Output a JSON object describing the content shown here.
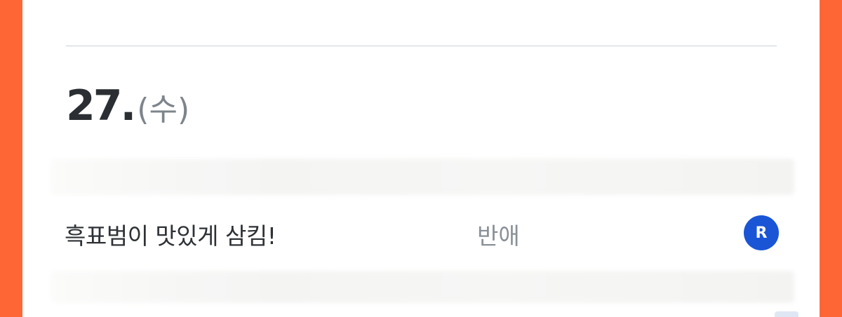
{
  "date_heading": {
    "day": "27.",
    "weekday": "(수)"
  },
  "entries": [
    {
      "title": "흑표범이 맛있게 삼킴!",
      "status": "반애",
      "badge": "R"
    }
  ],
  "colors": {
    "frame": "#fe6636",
    "badge": "#1a55d6",
    "title_text": "#2e3236",
    "muted_text": "#8a9097"
  }
}
